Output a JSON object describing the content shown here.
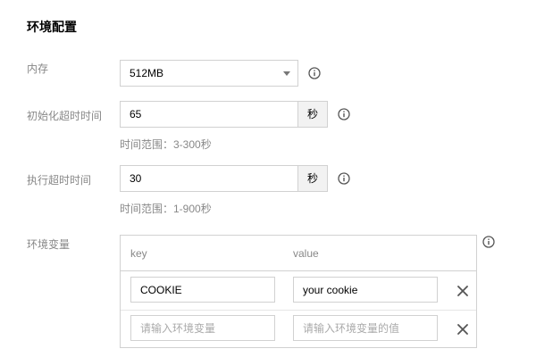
{
  "section": {
    "title": "环境配置"
  },
  "memory": {
    "label": "内存",
    "selected": "512MB"
  },
  "init_timeout": {
    "label": "初始化超时时间",
    "value": "65",
    "unit": "秒",
    "hint": "时间范围：3-300秒"
  },
  "exec_timeout": {
    "label": "执行超时时间",
    "value": "30",
    "unit": "秒",
    "hint": "时间范围：1-900秒"
  },
  "env_vars": {
    "label": "环境变量",
    "columns": {
      "key": "key",
      "value": "value"
    },
    "rows": [
      {
        "key": "COOKIE",
        "value": "your cookie"
      },
      {
        "key": "",
        "value": "",
        "key_placeholder": "请输入环境变量",
        "value_placeholder": "请输入环境变量的值"
      }
    ]
  },
  "icons": {
    "info": "info-circle-icon",
    "remove": "close-icon"
  },
  "colors": {
    "border": "#d1d1d1",
    "label": "#888888",
    "unit_bg": "#f2f2f2"
  }
}
